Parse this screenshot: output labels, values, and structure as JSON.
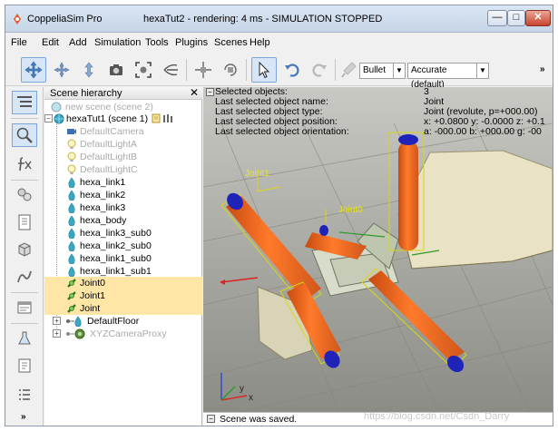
{
  "window": {
    "app_title": "CoppeliaSim Pro",
    "doc_title": "hexaTut2 - rendering: 4 ms - SIMULATION STOPPED",
    "minimize": "—",
    "maximize": "□",
    "close": "✕"
  },
  "menu": [
    "File",
    "Edit",
    "Add",
    "Simulation",
    "Tools",
    "Plugins",
    "Scenes",
    "Help"
  ],
  "toolbar": {
    "buttons": [
      "camera-pan-icon",
      "camera-rotate-icon",
      "camera-shift-icon",
      "camera-angle-icon",
      "fit-to-view-icon",
      "fly-icon",
      "object-shift-icon",
      "object-rotate-icon",
      "click-select-icon",
      "undo-icon",
      "redo-icon",
      "dynamics-toggle-icon"
    ],
    "engine": "Bullet",
    "precision": "Accurate (default)",
    "more": "»"
  },
  "left_toolbar": {
    "buttons": [
      "scene-objects-icon",
      "model-browser-icon",
      "scripts-icon",
      "collections-icon",
      "selection-icon",
      "objects-icon",
      "path-icon",
      "shapes-icon",
      "layers-icon",
      "joint-icon",
      "list-icon"
    ],
    "more": "»"
  },
  "hierarchy": {
    "title": "Scene hierarchy",
    "close": "✕",
    "items": [
      {
        "label": "new scene (scene 2)",
        "dim": true
      },
      {
        "label": "hexaTut1 (scene 1)",
        "dim": false
      },
      {
        "label": "DefaultCamera",
        "dim": true
      },
      {
        "label": "DefaultLightA",
        "dim": true
      },
      {
        "label": "DefaultLightB",
        "dim": true
      },
      {
        "label": "DefaultLightC",
        "dim": true
      },
      {
        "label": "hexa_link1",
        "dim": false
      },
      {
        "label": "hexa_link2",
        "dim": false
      },
      {
        "label": "hexa_link3",
        "dim": false
      },
      {
        "label": "hexa_body",
        "dim": false
      },
      {
        "label": "hexa_link3_sub0",
        "dim": false
      },
      {
        "label": "hexa_link2_sub0",
        "dim": false
      },
      {
        "label": "hexa_link1_sub0",
        "dim": false
      },
      {
        "label": "hexa_link1_sub1",
        "dim": false
      },
      {
        "label": "Joint0",
        "dim": false,
        "selected": true
      },
      {
        "label": "Joint1",
        "dim": false,
        "selected": true
      },
      {
        "label": "Joint",
        "dim": false,
        "selected": true
      },
      {
        "label": "DefaultFloor",
        "dim": false
      },
      {
        "label": "XYZCameraProxy",
        "dim": true
      }
    ]
  },
  "info": {
    "lines": [
      {
        "k": "Selected objects:",
        "v": "3"
      },
      {
        "k": "Last selected object name:",
        "v": "Joint"
      },
      {
        "k": "Last selected object type:",
        "v": "Joint (revolute, p=+000.00)"
      },
      {
        "k": "Last selected object position:",
        "v": "x: +0.0800    y: -0.0000    z: +0.1"
      },
      {
        "k": "Last selected object orientation:",
        "v": "a: -000.00    b: +000.00    g: -00"
      }
    ]
  },
  "viewport": {
    "labels": {
      "joint1": "Joint1",
      "joint0": "Joint0",
      "axis_x": "x",
      "axis_y": "y"
    }
  },
  "status": {
    "text": "Scene was saved.",
    "watermark": "https://blog.csdn.net/Csdn_Darry"
  }
}
